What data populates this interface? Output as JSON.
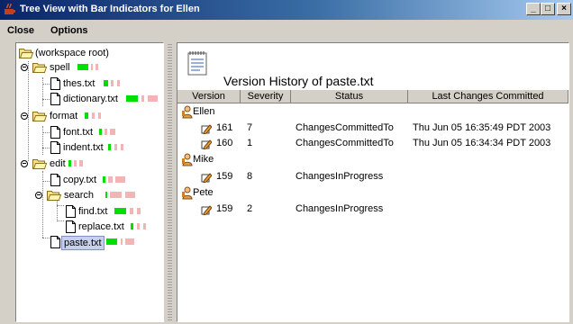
{
  "window": {
    "title": "Tree View with Bar Indicators for Ellen",
    "minimize": "_",
    "maximize": "□",
    "close": "×"
  },
  "menu": [
    "Close",
    "Options"
  ],
  "tree": [
    {
      "label": "(workspace root)"
    },
    {
      "label": "spell"
    },
    {
      "label": "thes.txt"
    },
    {
      "label": "dictionary.txt"
    },
    {
      "label": "format"
    },
    {
      "label": "font.txt"
    },
    {
      "label": "indent.txt"
    },
    {
      "label": "edit"
    },
    {
      "label": "copy.txt"
    },
    {
      "label": "search"
    },
    {
      "label": "find.txt"
    },
    {
      "label": "replace.txt"
    },
    {
      "label": "paste.txt",
      "selected": true
    }
  ],
  "details": {
    "title": "Version History of  paste.txt",
    "columns": [
      "Version",
      "Severity",
      "Status",
      "Last Changes Committed"
    ],
    "groups": [
      {
        "user": "Ellen",
        "rows": [
          {
            "version": "161",
            "severity": "7",
            "status": "ChangesCommittedTo",
            "date": "Thu Jun 05 16:35:49 PDT 2003"
          },
          {
            "version": "160",
            "severity": "1",
            "status": "ChangesCommittedTo",
            "date": "Thu Jun 05 16:34:34 PDT 2003"
          }
        ]
      },
      {
        "user": "Mike",
        "rows": [
          {
            "version": "159",
            "severity": "8",
            "status": "ChangesInProgress",
            "date": ""
          }
        ]
      },
      {
        "user": "Pete",
        "rows": [
          {
            "version": "159",
            "severity": "2",
            "status": "ChangesInProgress",
            "date": ""
          }
        ]
      }
    ]
  },
  "colors": {
    "green": "#00e000",
    "pink": "#f2b4b4",
    "selection": "#c8d0f0"
  }
}
